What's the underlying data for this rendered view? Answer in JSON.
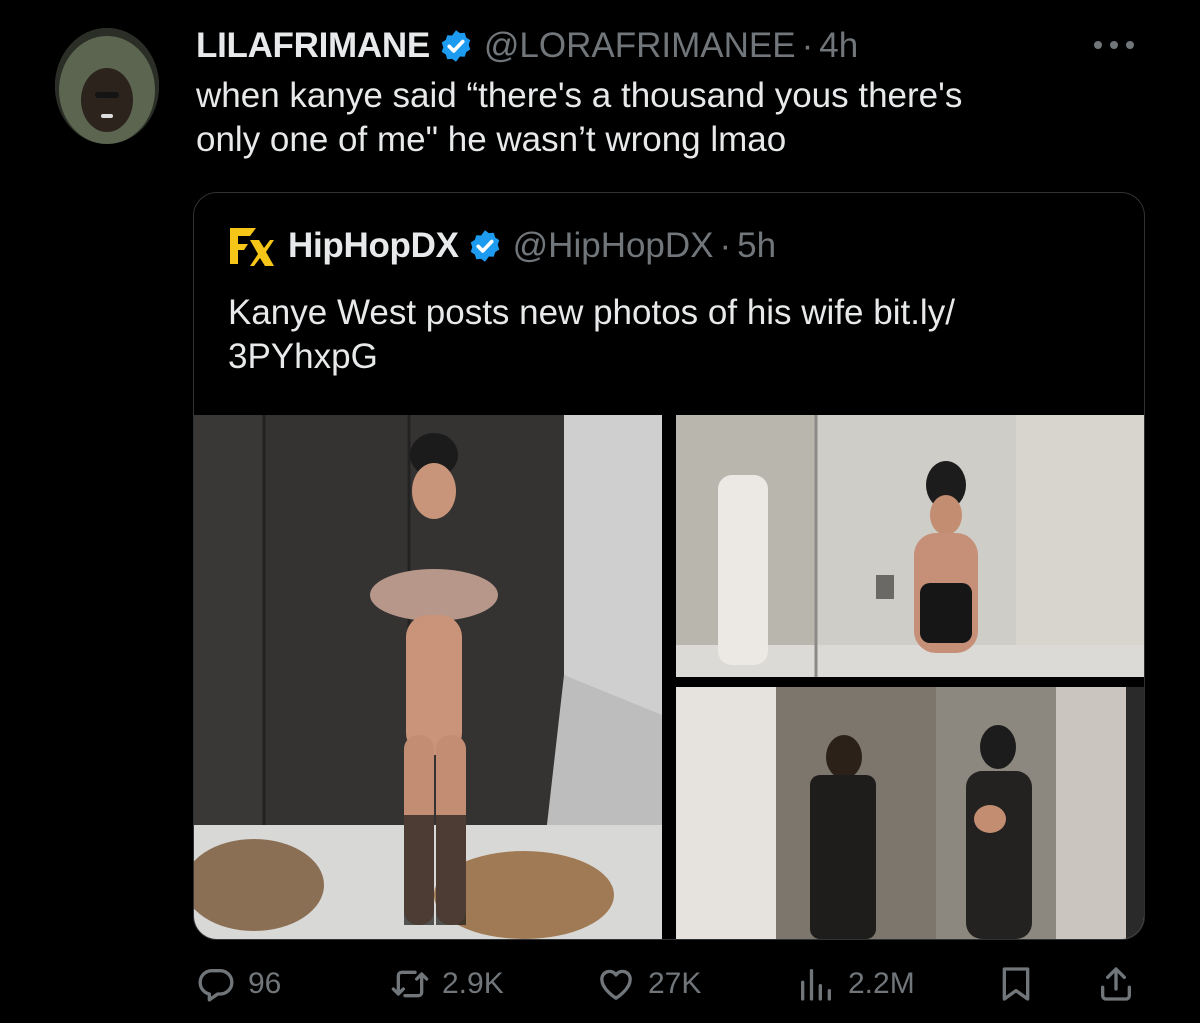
{
  "tweet": {
    "display_name": "LILAFRIMANE",
    "handle": "@LORAFRIMANEE",
    "separator": "·",
    "time": "4h",
    "text": "when kanye said “there's a thousand yous there's\nonly one of me\" he wasn’t wrong lmao",
    "more_icon": "more-horizontal-icon",
    "verified_icon": "verified-badge-icon",
    "accent_color": "#1d9bf0"
  },
  "quoted": {
    "display_name": "HipHopDX",
    "handle": "@HipHopDX",
    "separator": "·",
    "time": "5h",
    "text": "Kanye West posts new photos of his wife bit.ly/\n3PYhxpG",
    "logo_color": "#f5c518"
  },
  "actions": {
    "replies": "96",
    "reposts": "2.9K",
    "likes": "27K",
    "views": "2.2M",
    "icons": [
      "reply-icon",
      "repost-icon",
      "like-icon",
      "views-icon",
      "bookmark-icon",
      "share-icon"
    ]
  },
  "colors": {
    "background": "#000000",
    "text": "#e7e9ea",
    "muted": "#71767b",
    "border": "#2f3336"
  }
}
